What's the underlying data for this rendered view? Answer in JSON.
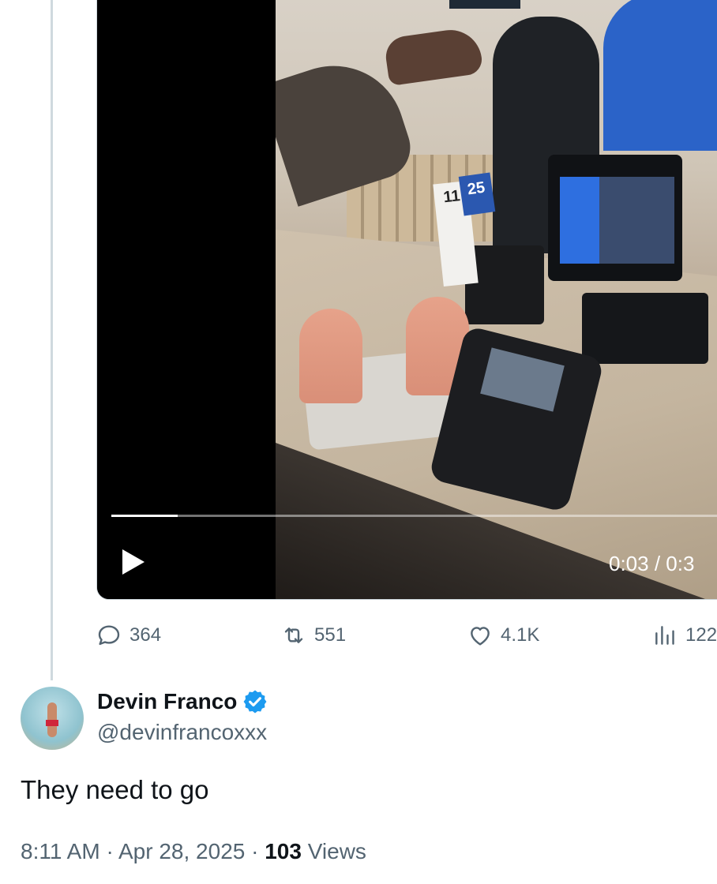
{
  "video": {
    "time_readout": "0:03 / 0:3",
    "progress_fraction": 0.108,
    "sign_number_1": "25",
    "sign_number_2": "11"
  },
  "actions": {
    "replies": "364",
    "reposts": "551",
    "likes": "4.1K",
    "views": "122"
  },
  "author": {
    "display_name": "Devin Franco",
    "handle": "@devinfrancoxxx",
    "verified": true
  },
  "tweet": {
    "text": "They need to go",
    "time": "8:11 AM",
    "separator": "·",
    "date": "Apr 28, 2025",
    "views_count": "103",
    "views_label": "Views"
  },
  "colors": {
    "secondary_text": "#536471",
    "primary_text": "#0f1419",
    "verified_blue": "#1d9bf0",
    "border": "#cfd9de"
  },
  "icons": {
    "reply": "reply-icon",
    "repost": "repost-icon",
    "like": "heart-icon",
    "views": "views-icon",
    "play": "play-icon",
    "verified": "verified-badge-icon"
  }
}
